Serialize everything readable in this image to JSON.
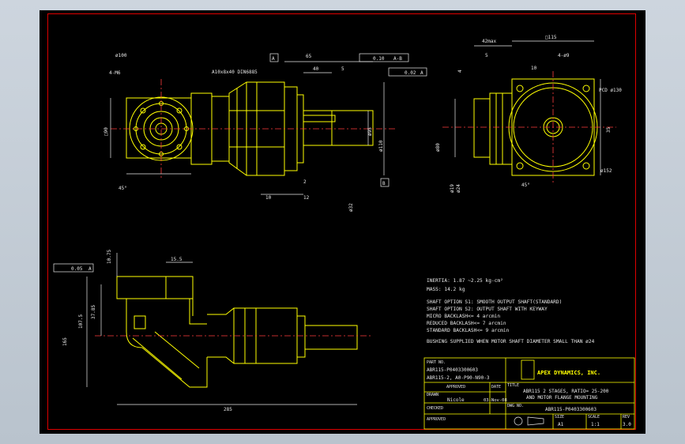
{
  "drawing": {
    "front_view": {
      "pcd_dia": "ø100",
      "tap": "4-M6",
      "square": "□90",
      "angle": "45°",
      "flange_spec": "A10x8x40 DIN6885",
      "dim_65": "65",
      "dim_40": "40",
      "dim_5": "5",
      "datum_a": "A",
      "datum_b": "B",
      "tol_flatness": "0.10",
      "tol_ref_ab": "A-B",
      "tol_runout": "0.02",
      "tol_ref_a": "A",
      "dim_95": "ø95",
      "dim_110": "ø110",
      "dim_32": "ø32",
      "dim_10": "10",
      "dim_12": "12",
      "dim_2": "2"
    },
    "side_view": {
      "dim_42max": "42max",
      "dim_115": "□115",
      "dim_5": "5",
      "dim_4": "4",
      "holes": "4-ø9",
      "dim_10": "10",
      "pcd": "PCD ø130",
      "dim_35": "35",
      "dim_80": "ø80",
      "dim_19": "ø19",
      "dim_24": "ø24",
      "dim_152": "ø152",
      "angle": "45°"
    },
    "lower_view": {
      "tol": "0.05",
      "datum": "A",
      "dim_1075": "10.75",
      "dim_155": "15.5",
      "dim_1075b": "107.5",
      "dim_165": "165",
      "dim_285": "285",
      "dim_37": "37.85"
    },
    "notes": {
      "inertia": "INERTIA:  1.87 ~2.25 kg-cm²",
      "mass": "MASS: 14.2 kg",
      "opt_s1": "SHAFT OPTION S1: SMOOTH OUTPUT SHAFT(STANDARD)",
      "opt_s2": "SHAFT OPTION S2: OUTPUT SHAFT WITH KEYWAY",
      "micro": "MICRO BACKLASH<= 4 arcmin",
      "reduced": "REDUCED BACKLASH<= 7 arcmin",
      "standard": "STANDARD BACKLASH<= 9 arcmin",
      "bushing": "BUSHING SUPPLIED WHEN MOTOR SHAFT DIAMETER SMALL THAN ø24"
    },
    "title_block": {
      "partno_label": "PART NO.",
      "partno1": "ABR115-P0403300603",
      "partno2": "ABR115-2, A0-P90-N90-3",
      "approved_label": "APPROVED",
      "date_label": "DATE",
      "drawn_label": "DRAWN",
      "drawn_by": "Nicole",
      "drawn_date": "03-Nov-08",
      "checked_label": "CHECKED",
      "approved2_label": "APPROVED",
      "company": "APEX DYNAMICS, INC.",
      "title_label": "TITLE",
      "title1": "ABR115 2 STAGES, RATIO= 25-200",
      "title2": "AND MOTOR FLANGE MOUNTING",
      "dwg_label": "DWG NO.",
      "dwg_no": "ABR115-P0403300603",
      "size_label": "SIZE",
      "size": "A1",
      "scale_label": "SCALE",
      "scale": "1:1",
      "rev_label": "REV",
      "rev": "3.0"
    },
    "colors": {
      "line": "#ffff00",
      "center": "#ff3b3b",
      "dim": "#e8e8e8",
      "border": "#dd0000"
    }
  }
}
